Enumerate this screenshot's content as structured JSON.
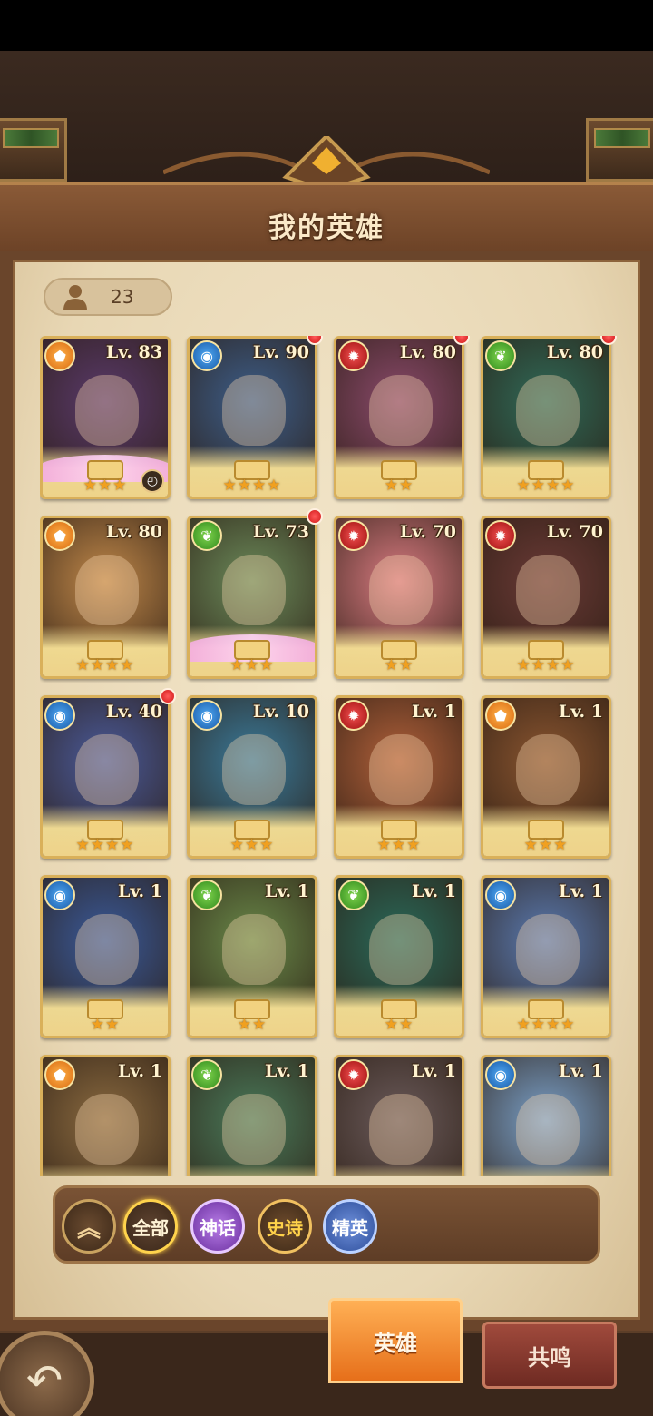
{
  "title": "我的英雄",
  "hero_count": "23",
  "heroes": [
    {
      "level": "Lv. 83",
      "element": "earth",
      "stars": "★★★",
      "red_dot": false,
      "bg": "#5a3a6b",
      "wings": true,
      "clock": true
    },
    {
      "level": "Lv. 90",
      "element": "water",
      "stars": "★★★★",
      "red_dot": true,
      "bg": "#3d5e8a",
      "wings": false,
      "clock": false
    },
    {
      "level": "Lv. 80",
      "element": "fire",
      "stars": "★★",
      "red_dot": true,
      "bg": "#8a4a6b",
      "wings": false,
      "clock": false
    },
    {
      "level": "Lv. 80",
      "element": "nature",
      "stars": "★★★★",
      "red_dot": true,
      "bg": "#2f6a58",
      "wings": false,
      "clock": false
    },
    {
      "level": "Lv. 80",
      "element": "earth",
      "stars": "★★★★",
      "red_dot": false,
      "bg": "#c0884a",
      "wings": false,
      "clock": false
    },
    {
      "level": "Lv. 73",
      "element": "nature",
      "stars": "★★★",
      "red_dot": true,
      "bg": "#6b8a5a",
      "wings": true,
      "clock": false
    },
    {
      "level": "Lv. 70",
      "element": "fire",
      "stars": "★★",
      "red_dot": false,
      "bg": "#d77a80",
      "wings": false,
      "clock": false
    },
    {
      "level": "Lv. 70",
      "element": "fire",
      "stars": "★★★★",
      "red_dot": false,
      "bg": "#6a3a36",
      "wings": false,
      "clock": false
    },
    {
      "level": "Lv. 40",
      "element": "water",
      "stars": "★★★★",
      "red_dot": true,
      "bg": "#4a5a9a",
      "wings": false,
      "clock": false
    },
    {
      "level": "Lv. 10",
      "element": "water",
      "stars": "★★★",
      "red_dot": false,
      "bg": "#3a7a9a",
      "wings": false,
      "clock": false
    },
    {
      "level": "Lv. 1",
      "element": "fire",
      "stars": "★★★",
      "red_dot": false,
      "bg": "#b0603a",
      "wings": false,
      "clock": false
    },
    {
      "level": "Lv. 1",
      "element": "earth",
      "stars": "★★★",
      "red_dot": false,
      "bg": "#8a5530",
      "wings": false,
      "clock": false
    },
    {
      "level": "Lv. 1",
      "element": "water",
      "stars": "★★",
      "red_dot": false,
      "bg": "#3a5a9a",
      "wings": false,
      "clock": false
    },
    {
      "level": "Lv. 1",
      "element": "nature",
      "stars": "★★",
      "red_dot": false,
      "bg": "#6a8a4a",
      "wings": false,
      "clock": false
    },
    {
      "level": "Lv. 1",
      "element": "nature",
      "stars": "★★",
      "red_dot": false,
      "bg": "#2a6a5a",
      "wings": false,
      "clock": false
    },
    {
      "level": "Lv. 1",
      "element": "water",
      "stars": "★★★★",
      "red_dot": false,
      "bg": "#5a7ab0",
      "wings": false,
      "clock": false
    },
    {
      "level": "Lv. 1",
      "element": "earth",
      "stars": "",
      "red_dot": false,
      "bg": "#8a6a40",
      "wings": false,
      "clock": false
    },
    {
      "level": "Lv. 1",
      "element": "nature",
      "stars": "",
      "red_dot": false,
      "bg": "#4a7a5a",
      "wings": false,
      "clock": false
    },
    {
      "level": "Lv. 1",
      "element": "fire",
      "stars": "",
      "red_dot": false,
      "bg": "#6a5a5a",
      "wings": false,
      "clock": false
    },
    {
      "level": "Lv. 1",
      "element": "water",
      "stars": "",
      "red_dot": false,
      "bg": "#7aa0c8",
      "wings": false,
      "clock": false
    }
  ],
  "element_icons": {
    "fire": "✹",
    "water": "◉",
    "earth": "⬟",
    "nature": "❦"
  },
  "filters": {
    "collapse": "︽",
    "all": "全部",
    "myth": "神话",
    "epic": "史诗",
    "elite": "精英"
  },
  "tabs": {
    "heroes": "英雄",
    "resonance": "共鸣"
  },
  "back_icon": "↶",
  "clock_icon": "◴",
  "person_icon": "person-icon"
}
